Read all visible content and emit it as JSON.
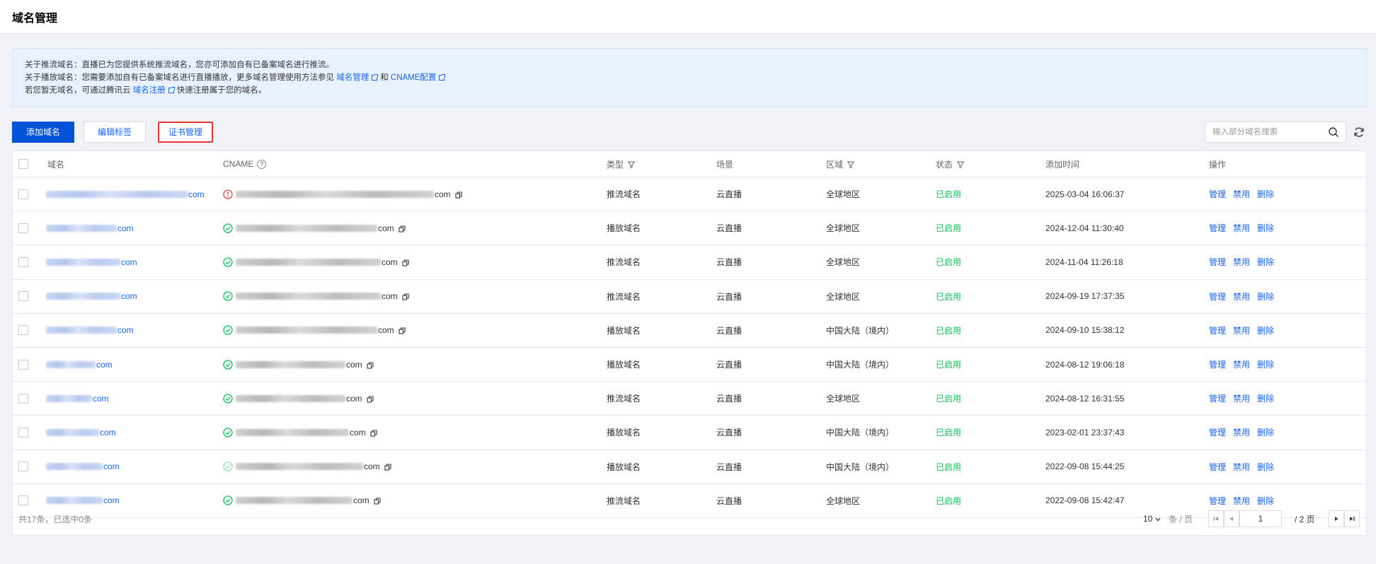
{
  "page": {
    "title": "域名管理"
  },
  "notice": {
    "line1": "关于推流域名：直播已为您提供系统推流域名，您亦可添加自有已备案域名进行推流。",
    "line2_prefix": "关于播放域名：您需要添加自有已备案域名进行直播播放，更多域名管理使用方法参见",
    "line2_link1": "域名管理",
    "line2_and": "和",
    "line2_link2": "CNAME配置",
    "line3_prefix": "若您暂无域名，可通过腾讯云",
    "line3_link": "域名注册",
    "line3_suffix": "快速注册属于您的域名。"
  },
  "toolbar": {
    "add_label": "添加域名",
    "tag_label": "编辑标签",
    "cert_label": "证书管理",
    "search_placeholder": "输入部分域名搜索"
  },
  "table": {
    "headers": {
      "domain": "域名",
      "cname": "CNAME",
      "type": "类型",
      "scene": "场景",
      "region": "区域",
      "status": "状态",
      "time": "添加时间",
      "ops": "操作"
    },
    "ops": {
      "manage": "管理",
      "disable": "禁用",
      "delete": "删除"
    },
    "rows": [
      {
        "domain_suffix": "com",
        "cname_suffix": "com",
        "cname_state": "error",
        "type": "推流域名",
        "scene": "云直播",
        "region": "全球地区",
        "status": "已启用",
        "time": "2025-03-04 16:06:37"
      },
      {
        "domain_suffix": "com",
        "cname_suffix": "com",
        "cname_state": "ok",
        "type": "播放域名",
        "scene": "云直播",
        "region": "全球地区",
        "status": "已启用",
        "time": "2024-12-04 11:30:40"
      },
      {
        "domain_suffix": "com",
        "cname_suffix": "com",
        "cname_state": "ok",
        "type": "推流域名",
        "scene": "云直播",
        "region": "全球地区",
        "status": "已启用",
        "time": "2024-11-04 11:26:18"
      },
      {
        "domain_suffix": "com",
        "cname_suffix": "com",
        "cname_state": "ok",
        "type": "推流域名",
        "scene": "云直播",
        "region": "全球地区",
        "status": "已启用",
        "time": "2024-09-19 17:37:35"
      },
      {
        "domain_suffix": "com",
        "cname_suffix": "com",
        "cname_state": "ok",
        "type": "播放域名",
        "scene": "云直播",
        "region": "中国大陆（境内）",
        "status": "已启用",
        "time": "2024-09-10 15:38:12"
      },
      {
        "domain_suffix": "com",
        "cname_suffix": "com",
        "cname_state": "ok",
        "type": "播放域名",
        "scene": "云直播",
        "region": "中国大陆（境内）",
        "status": "已启用",
        "time": "2024-08-12 19:06:18"
      },
      {
        "domain_suffix": "com",
        "cname_suffix": "com",
        "cname_state": "ok",
        "type": "推流域名",
        "scene": "云直播",
        "region": "全球地区",
        "status": "已启用",
        "time": "2024-08-12 16:31:55"
      },
      {
        "domain_suffix": "com",
        "cname_suffix": "com",
        "cname_state": "ok",
        "type": "播放域名",
        "scene": "云直播",
        "region": "中国大陆（境内）",
        "status": "已启用",
        "time": "2023-02-01 23:37:43"
      },
      {
        "domain_suffix": "com",
        "cname_suffix": "com",
        "cname_state": "ok-light",
        "type": "播放域名",
        "scene": "云直播",
        "region": "中国大陆（境内）",
        "status": "已启用",
        "time": "2022-09-08 15:44:25"
      },
      {
        "domain_suffix": "com",
        "cname_suffix": "com",
        "cname_state": "ok",
        "type": "推流域名",
        "scene": "云直播",
        "region": "全球地区",
        "status": "已启用",
        "time": "2022-09-08 15:42:47"
      }
    ]
  },
  "footer": {
    "summary": "共17条，已选中0条",
    "page_size": "10",
    "page_size_unit": "条 / 页",
    "current_page": "1",
    "total_pages": "/ 2 页"
  },
  "colors": {
    "primary": "#0052d9",
    "link": "#1664ff",
    "success": "#0abf5b",
    "error": "#e54545"
  }
}
